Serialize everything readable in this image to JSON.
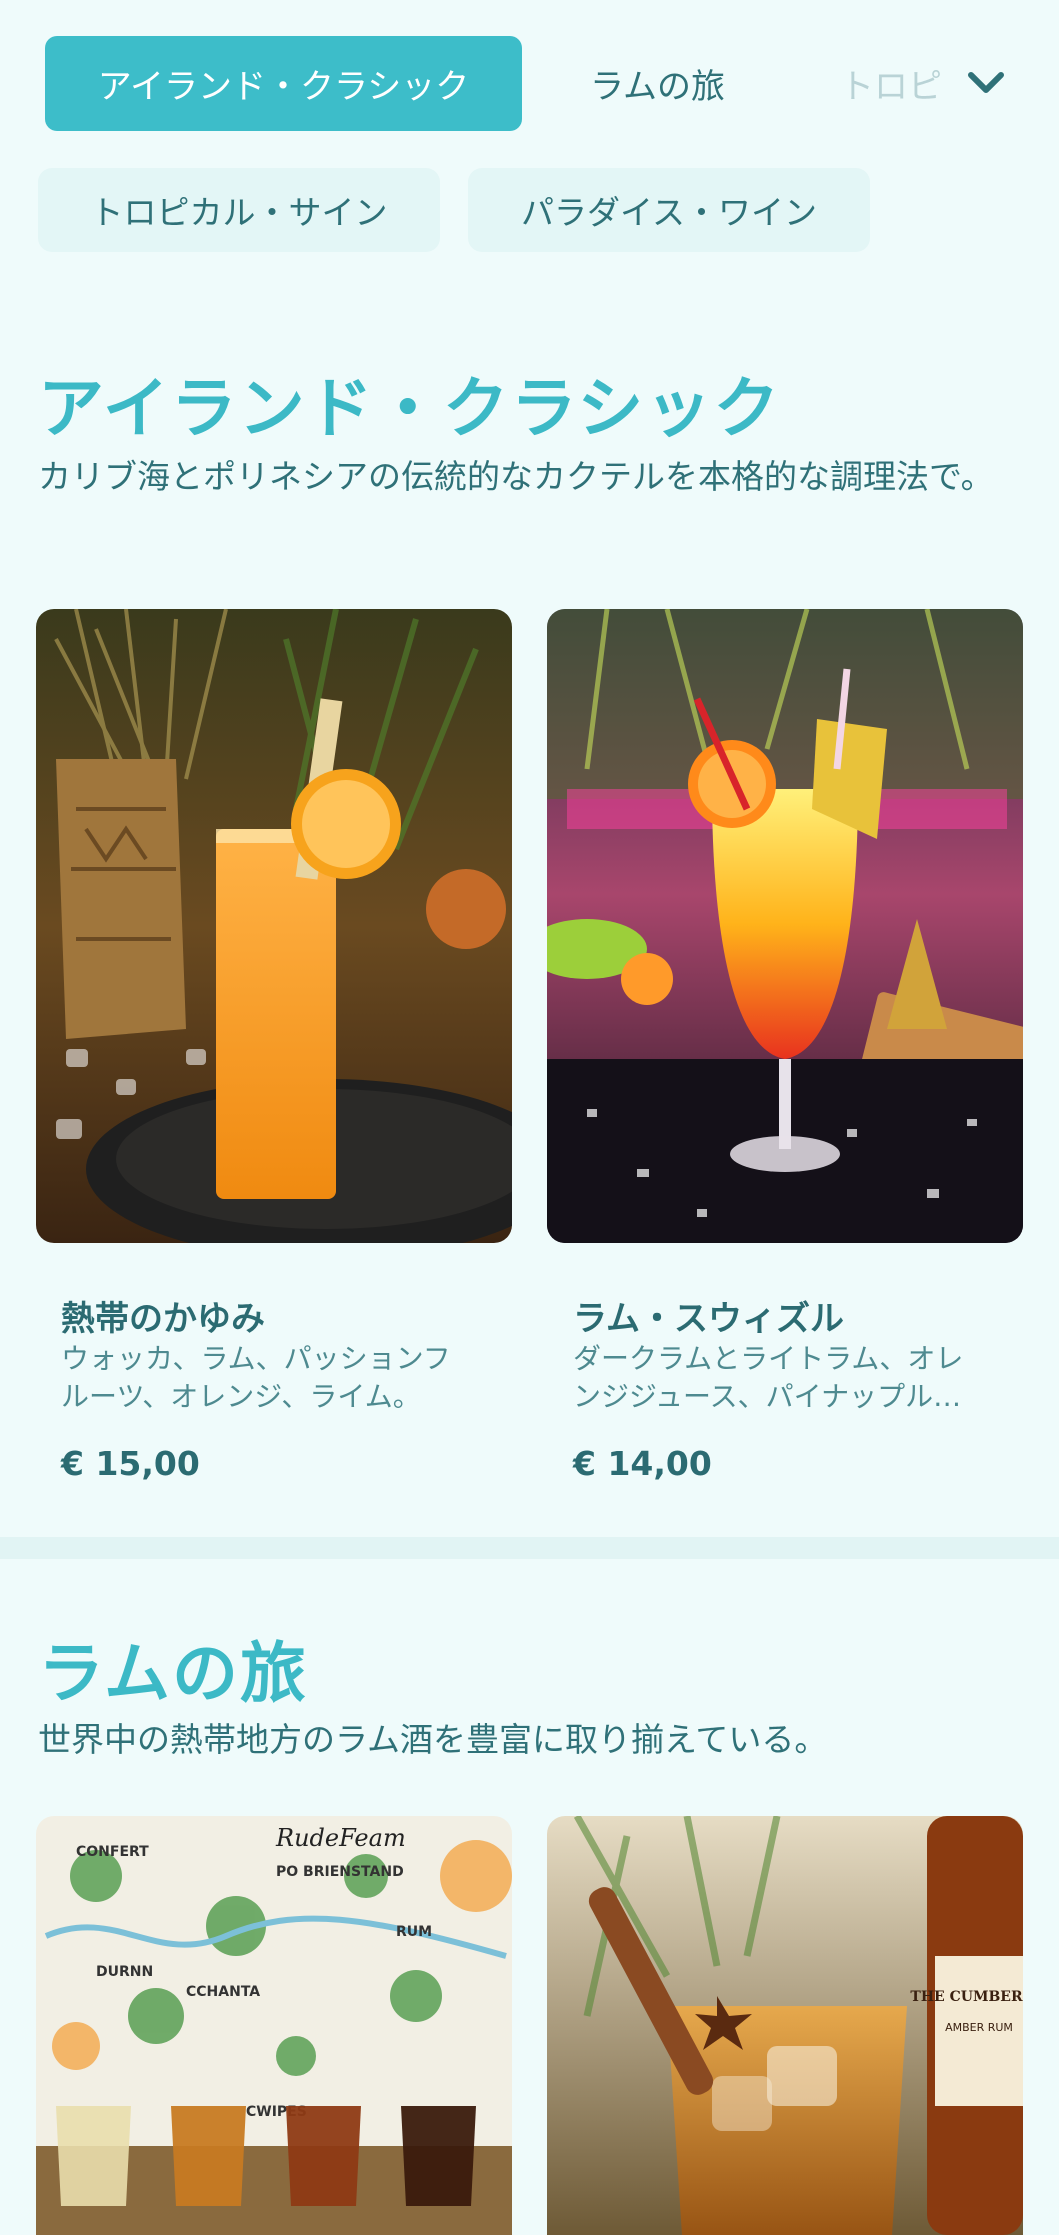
{
  "nav": {
    "active_tab": "アイランド・クラシック",
    "tab2": "ラムの旅",
    "tab3_partial": "トロピ",
    "chips": [
      "トロピカル・サイン",
      "パラダイス・ワイン"
    ]
  },
  "sections": [
    {
      "title": "アイランド・クラシック",
      "description": "カリブ海とポリネシアの伝統的なカクテルを本格的な調理法で。",
      "items": [
        {
          "name": "熱帯のかゆみ",
          "description_line1": "ウォッカ、ラム、パッションフ",
          "description_line2": "ルーツ、オレンジ、ライム。",
          "price": "€ 15,00"
        },
        {
          "name": "ラム・スウィズル",
          "description_line1": "ダークラムとライトラム、オレ",
          "description_line2": "ンジジュース、パイナップル…",
          "price": "€ 14,00"
        }
      ]
    },
    {
      "title": "ラムの旅",
      "description": "世界中の熱帯地方のラム酒を豊富に取り揃えている。",
      "image_texts": {
        "map_brand": "RudeFeam",
        "bottle_brand": "THE CUMBERON",
        "bottle_sub": "AMBER RUM"
      }
    }
  ],
  "colors": {
    "accent": "#3dbdc9",
    "background": "#effbfb",
    "text": "#2f7178"
  }
}
